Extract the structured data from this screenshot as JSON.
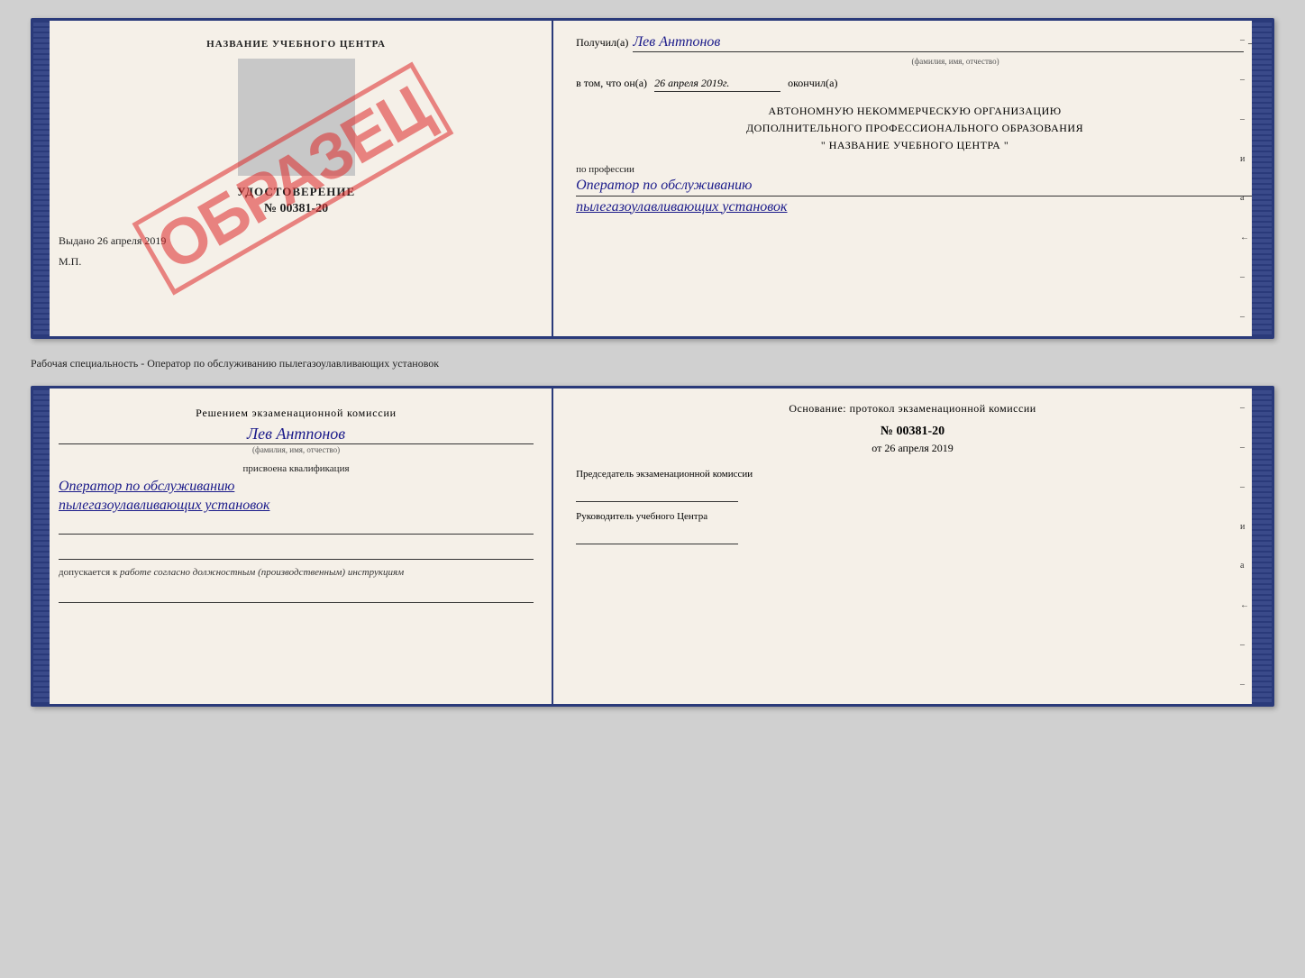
{
  "page": {
    "background": "#d0d0d0"
  },
  "top_doc": {
    "left": {
      "school_name": "НАЗВАНИЕ УЧЕБНОГО ЦЕНТРА",
      "stamp_placeholder": "",
      "watermark": "ОБРАЗЕЦ",
      "title": "УДОСТОВЕРЕНИЕ",
      "number": "№ 00381-20",
      "vydano_label": "Выдано",
      "vydano_date": "26 апреля 2019",
      "mp": "М.П."
    },
    "right": {
      "poluchil_label": "Получил(а)",
      "poluchil_name": "Лев Антпонов",
      "fio_hint": "(фамилия, имя, отчество)",
      "vtom_label": "в том, что он(а)",
      "date_value": "26 апреля 2019г.",
      "okonchil_label": "окончил(а)",
      "org_line1": "АВТОНОМНУЮ НЕКОММЕРЧЕСКУЮ ОРГАНИЗАЦИЮ",
      "org_line2": "ДОПОЛНИТЕЛЬНОГО ПРОФЕССИОНАЛЬНОГО ОБРАЗОВАНИЯ",
      "org_quote_open": "\"",
      "school_name_center": "НАЗВАНИЕ УЧЕБНОГО ЦЕНТРА",
      "org_quote_close": "\"",
      "po_professii_label": "по профессии",
      "profession_line1": "Оператор по обслуживанию",
      "profession_line2": "пылегазоулавливающих установок"
    }
  },
  "separator": {
    "text": "Рабочая специальность - Оператор по обслуживанию пылегазоулавливающих установок"
  },
  "bottom_doc": {
    "left": {
      "resheniem_label": "Решением экзаменационной комиссии",
      "person_name": "Лев Антпонов",
      "fio_hint": "(фамилия, имя, отчество)",
      "prisvoena_label": "присвоена квалификация",
      "kval_line1": "Оператор по обслуживанию",
      "kval_line2": "пылегазоулавливающих установок",
      "dopuskaetsya_label": "допускается к",
      "dopuskaetsya_text": "работе согласно должностным (производственным) инструкциям"
    },
    "right": {
      "osnovanie_label": "Основание: протокол экзаменационной комиссии",
      "number": "№  00381-20",
      "ot_label": "от",
      "date_value": "26 апреля 2019",
      "chairman_label": "Председатель экзаменационной комиссии",
      "rukovoditel_label": "Руководитель учебного Центра"
    },
    "right_dashes": [
      "-",
      "-",
      "-",
      "-",
      "и",
      "а",
      "←",
      "-",
      "-",
      "-",
      "-"
    ]
  }
}
